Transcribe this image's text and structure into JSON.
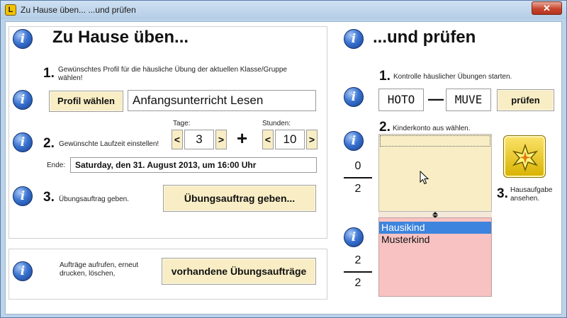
{
  "window": {
    "title": "Zu Hause üben...  ...und prüfen",
    "close_label": "✕",
    "app_icon_label": "L"
  },
  "info_icon_glyph": "i",
  "left": {
    "heading": "Zu Hause üben...",
    "step1": {
      "number": "1.",
      "text": "Gewünschtes Profil für die häusliche Übung der aktuellen Klasse/Gruppe wählen!",
      "button": "Profil wählen",
      "profile_value": "Anfangsunterricht Lesen"
    },
    "step2": {
      "number": "2.",
      "text": "Gewünschte Laufzeit einstellen!",
      "days_label": "Tage:",
      "days_value": "3",
      "hours_label": "Stunden:",
      "hours_value": "10",
      "dec_label": "<",
      "inc_label": ">",
      "plus": "+",
      "end_label": "Ende:",
      "end_value": "Saturday, den 31. August 2013, um 16:00 Uhr"
    },
    "step3": {
      "number": "3.",
      "text": "Übungsauftrag geben.",
      "button": "Übungsauftrag geben..."
    },
    "existing": {
      "text": "Aufträge aufrufen, erneut drucken, löschen,",
      "button": "vorhandene Übungsaufträge"
    }
  },
  "right": {
    "heading": "...und prüfen",
    "step1": {
      "number": "1.",
      "text": "Kontrolle häuslicher Übungen starten.",
      "code1": "HOTO",
      "dash": "—",
      "code2": "MUVE",
      "button": "prüfen"
    },
    "step2": {
      "number": "2.",
      "text": "Kinderkonto aus wählen."
    },
    "fraction_top": {
      "numerator": "0",
      "denominator": "2"
    },
    "fraction_bottom": {
      "numerator": "2",
      "denominator": "2"
    },
    "children": [
      "Hausikind",
      "Musterkind"
    ],
    "selected_child": "Hausikind",
    "step3": {
      "number": "3.",
      "text": "Hausaufgabe ansehen."
    }
  },
  "colors": {
    "upper_list_bg": "#f8edc4",
    "lower_list_bg": "#f8c2c2",
    "selection_bg": "#3c84dd",
    "button_bg": "#f8edc4"
  }
}
